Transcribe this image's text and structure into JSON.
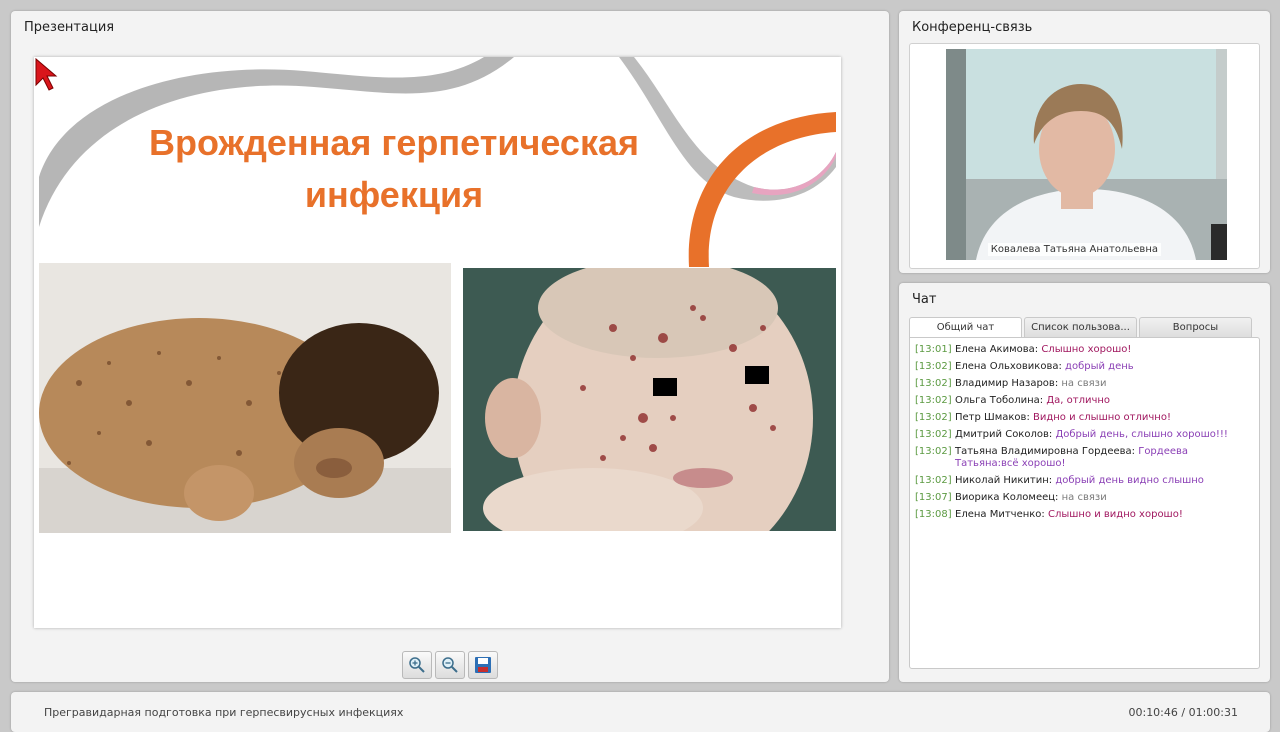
{
  "presentation": {
    "title": "Презентация",
    "slide_title": "Врожденная герпетическая инфекция",
    "colors": {
      "accent": "#e8712a",
      "ribbon": "#a9a9a9"
    }
  },
  "toolbar": {
    "zoom_in_icon": "zoom-in-icon",
    "zoom_out_icon": "zoom-out-icon",
    "save_icon": "save-icon"
  },
  "conference": {
    "title": "Конференц-связь",
    "speaker": "Ковалева Татьяна Анатольевна"
  },
  "chat": {
    "title": "Чат",
    "tabs": [
      "Общий чат",
      "Список пользова...",
      "Вопросы"
    ],
    "messages": [
      {
        "time": "[13:01]",
        "author": "Елена Акимова:",
        "text": "Слышно хорошо!"
      },
      {
        "time": "[13:02]",
        "author": "Елена Ольховикова:",
        "text": "добрый день"
      },
      {
        "time": "[13:02]",
        "author": "Владимир Назаров:",
        "text": "на связи"
      },
      {
        "time": "[13:02]",
        "author": "Ольга Тоболина:",
        "text": "Да, отлично"
      },
      {
        "time": "[13:02]",
        "author": "Петр Шмаков:",
        "text": "Видно и слышно отлично!"
      },
      {
        "time": "[13:02]",
        "author": "Дмитрий Соколов:",
        "text": "Добрый день, слышно хорошо!!!"
      },
      {
        "time": "[13:02]",
        "author": "Татьяна Владимировна Гордеева:",
        "text": "Гордеева Татьяна:всё хорошо!"
      },
      {
        "time": "[13:02]",
        "author": "Николай Никитин:",
        "text": "добрый день видно слышно"
      },
      {
        "time": "[13:07]",
        "author": "Виорика Коломеец:",
        "text": "на связи"
      },
      {
        "time": "[13:08]",
        "author": "Елена Митченко:",
        "text": "Слышно и видно хорошо!"
      }
    ]
  },
  "footer": {
    "course_title": "Прегравидарная подготовка при герпесвирусных инфекциях",
    "timecode": "00:10:46 / 01:00:31"
  }
}
